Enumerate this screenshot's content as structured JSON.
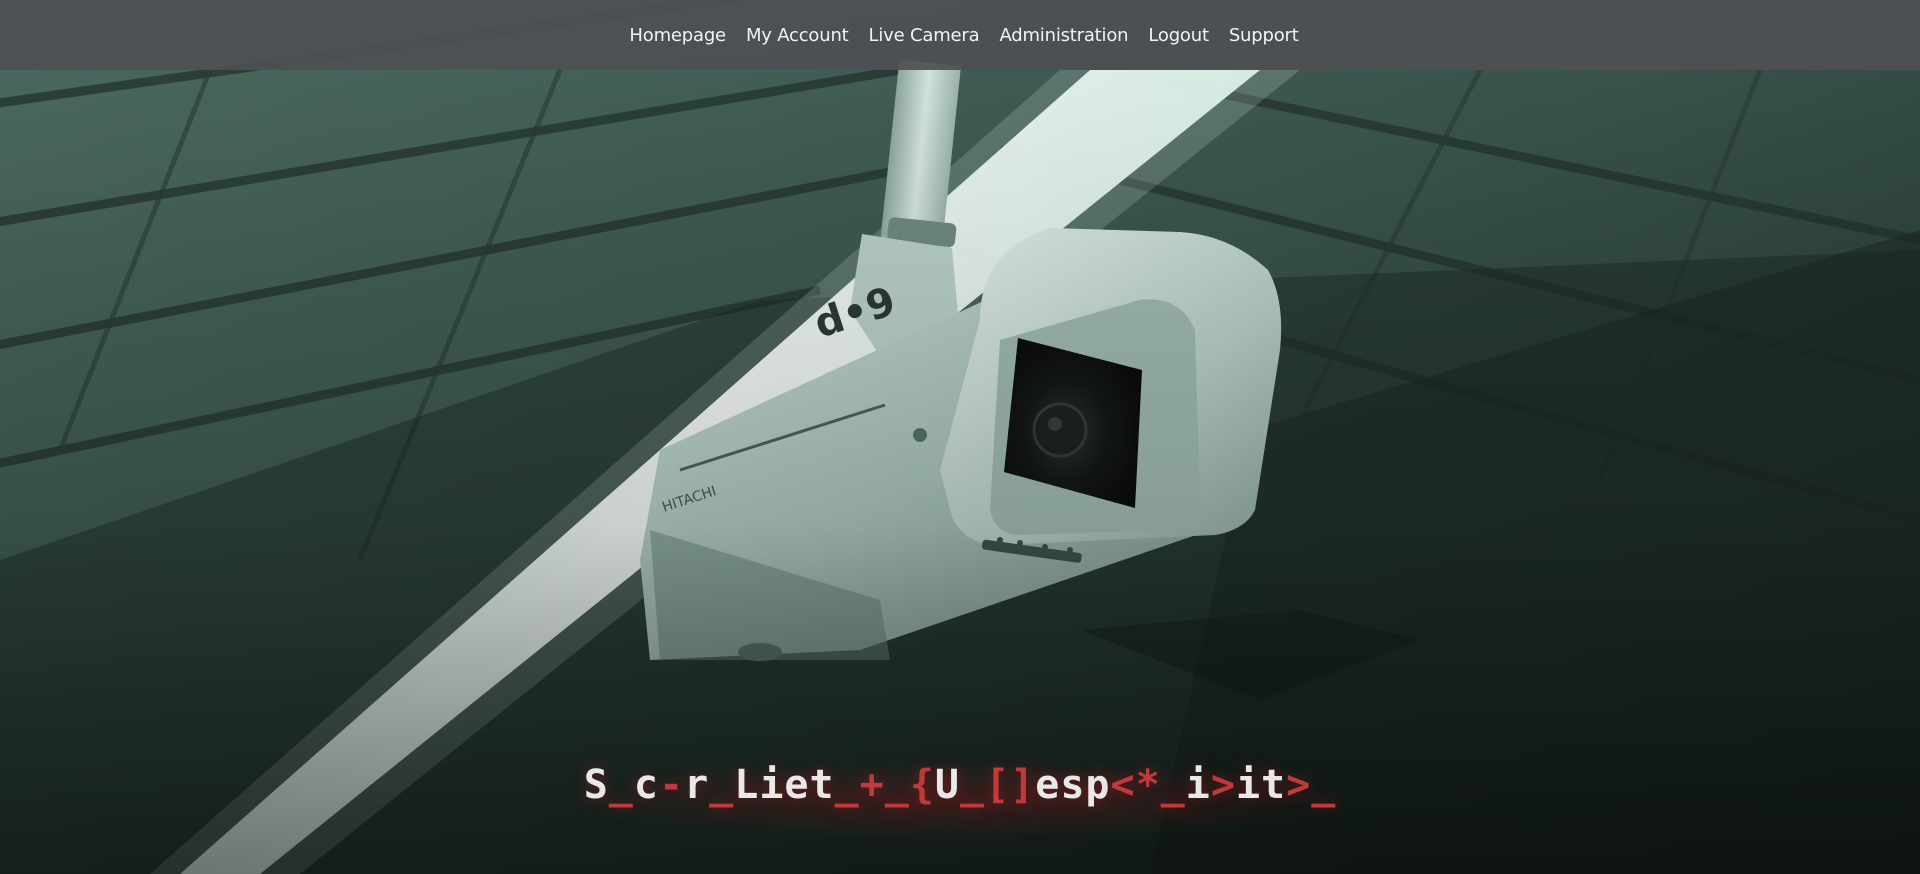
{
  "nav": {
    "items": [
      {
        "label": "Homepage"
      },
      {
        "label": "My Account"
      },
      {
        "label": "Live Camera"
      },
      {
        "label": "Administration"
      },
      {
        "label": "Logout"
      },
      {
        "label": "Support"
      }
    ]
  },
  "hero": {
    "title_segments": [
      {
        "text": "S",
        "accent": false
      },
      {
        "text": "_",
        "accent": true
      },
      {
        "text": "c",
        "accent": false
      },
      {
        "text": "-",
        "accent": true
      },
      {
        "text": "r",
        "accent": false
      },
      {
        "text": "_",
        "accent": true
      },
      {
        "text": "Liet",
        "accent": false
      },
      {
        "text": "_+_",
        "accent": true
      },
      {
        "text": "{",
        "accent": true
      },
      {
        "text": "U",
        "accent": false
      },
      {
        "text": "_[]",
        "accent": true
      },
      {
        "text": "esp",
        "accent": false
      },
      {
        "text": "<*_",
        "accent": true
      },
      {
        "text": "i",
        "accent": false
      },
      {
        "text": ">",
        "accent": true
      },
      {
        "text": "it",
        "accent": false
      },
      {
        "text": ">_",
        "accent": true
      }
    ]
  },
  "colors": {
    "nav_background": "#4e5054",
    "nav_text": "#f2f2f2",
    "title_text": "#e9e9e9",
    "title_accent": "#c0393b",
    "scene_tint": "#3d5a52"
  },
  "background": {
    "icon": "security-camera-image"
  }
}
